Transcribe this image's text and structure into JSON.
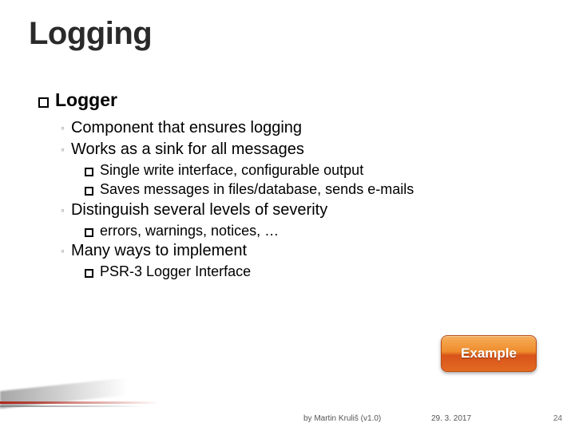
{
  "title": "Logging",
  "section": {
    "heading": "Logger",
    "points": [
      {
        "text": "Component that ensures logging",
        "sub": []
      },
      {
        "text": "Works as a sink for all messages",
        "sub": [
          "Single write interface, configurable output",
          "Saves messages in files/database, sends e-mails"
        ]
      },
      {
        "text": "Distinguish several levels of severity",
        "sub": [
          "errors, warnings, notices, …"
        ]
      },
      {
        "text": "Many ways to implement",
        "sub": [
          "PSR-3 Logger Interface"
        ]
      }
    ]
  },
  "button": {
    "label": "Example"
  },
  "footer": {
    "byline": "by Martin Kruliš (v1.0)",
    "date": "29. 3. 2017",
    "page": "24"
  }
}
